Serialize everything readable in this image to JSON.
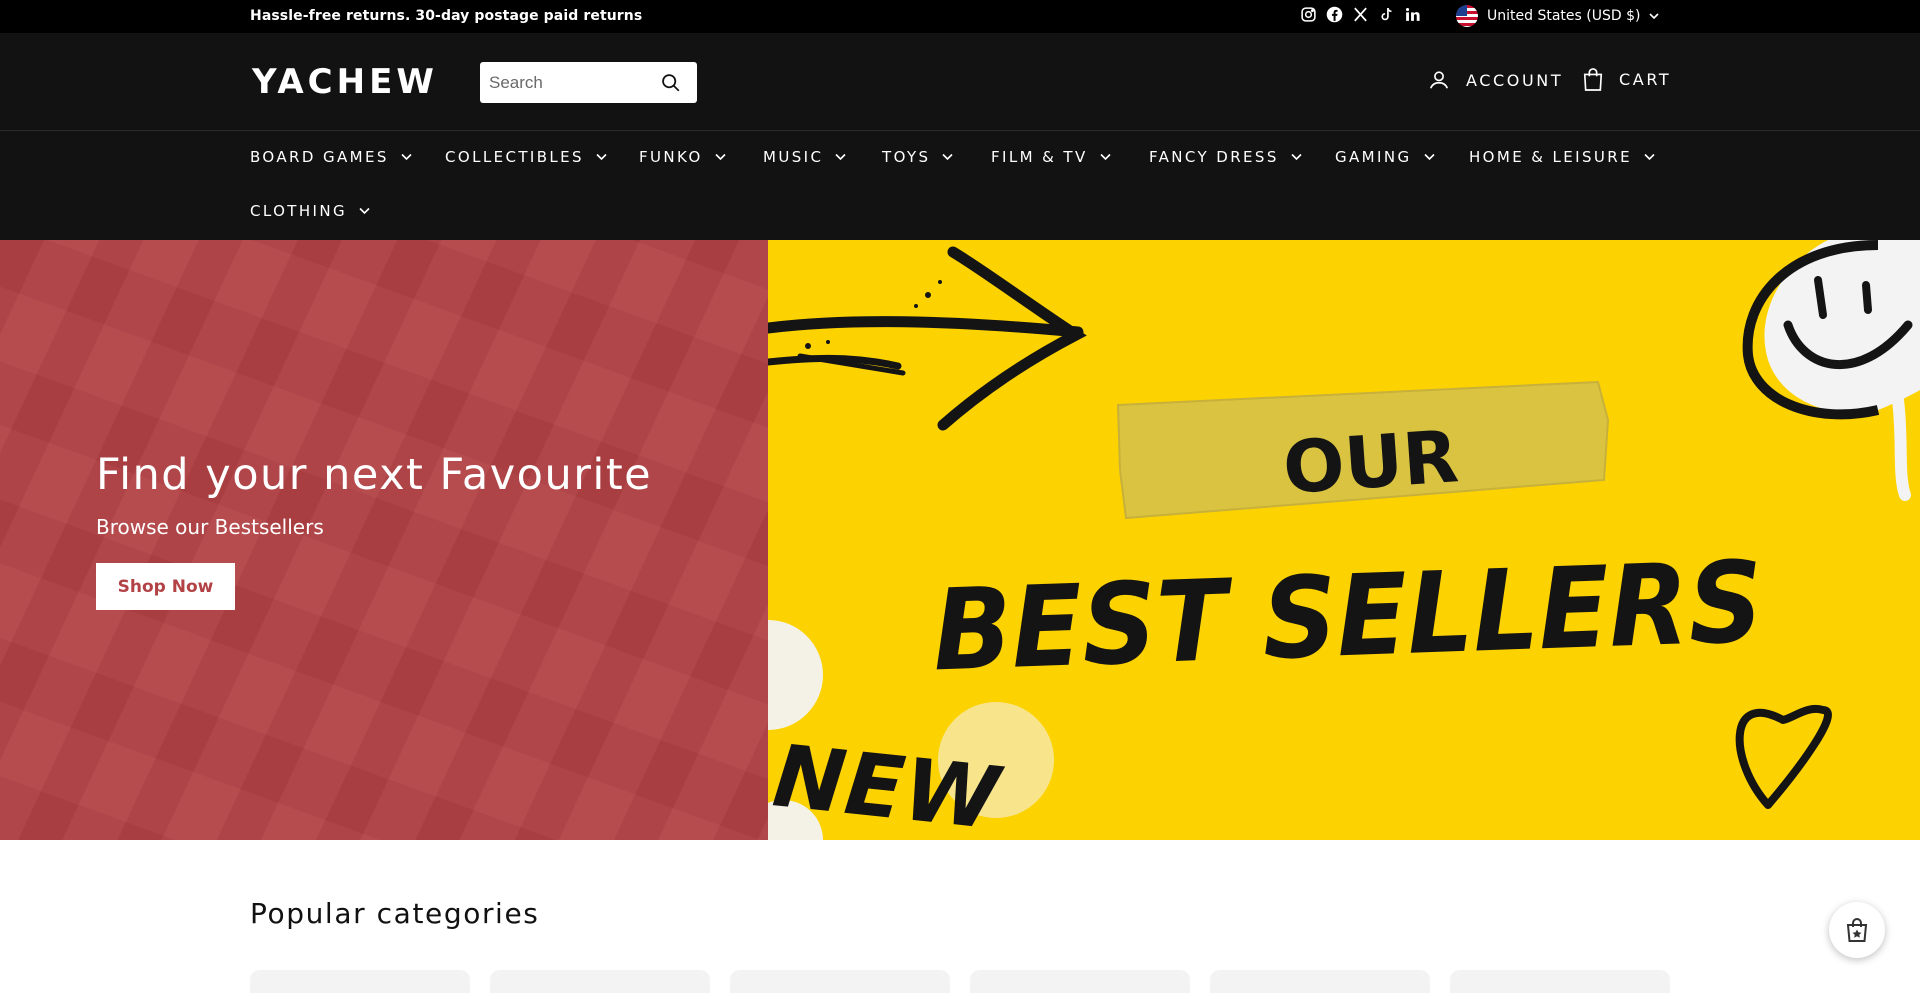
{
  "announcement": {
    "text": "Hassle-free returns. 30-day postage paid returns"
  },
  "socials": [
    "instagram-icon",
    "facebook-icon",
    "x-icon",
    "tiktok-icon",
    "linkedin-icon"
  ],
  "region": {
    "label": "United States (USD $)",
    "flag": "us-flag-icon"
  },
  "header": {
    "logo": "YACHEW",
    "search_placeholder": "Search",
    "account_label": "ACCOUNT",
    "cart_label": "CART"
  },
  "nav": {
    "items": [
      {
        "label": "BOARD GAMES"
      },
      {
        "label": "COLLECTIBLES"
      },
      {
        "label": "FUNKO"
      },
      {
        "label": "MUSIC"
      },
      {
        "label": "TOYS"
      },
      {
        "label": "FILM & TV"
      },
      {
        "label": "FANCY DRESS"
      },
      {
        "label": "GAMING"
      },
      {
        "label": "HOME & LEISURE"
      },
      {
        "label": "CLOTHING"
      }
    ]
  },
  "hero": {
    "title": "Find your next Favourite",
    "subtitle": "Browse our Bestsellers",
    "button": "Shop Now",
    "banner_small": "OUR",
    "banner_big": "BEST SELLERS",
    "banner_fragment": "NEW",
    "colors": {
      "left_bg": "#b24245",
      "right_bg": "#fdd201"
    }
  },
  "categories": {
    "title": "Popular categories"
  }
}
